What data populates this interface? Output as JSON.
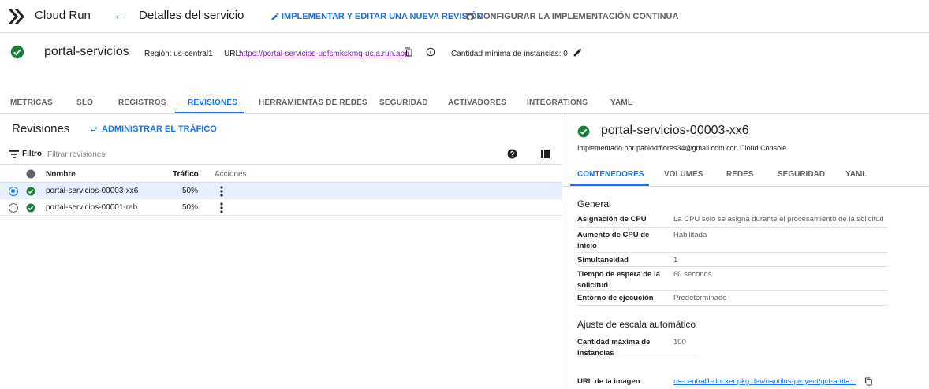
{
  "topbar": {
    "product": "Cloud Run",
    "page_title": "Detalles del servicio",
    "deploy_action": "IMPLEMENTAR Y EDITAR UNA NUEVA REVISIÓN",
    "cd_action": "CONFIGURAR LA IMPLEMENTACIÓN CONTINUA"
  },
  "service": {
    "name": "portal-servicios",
    "region": "Región: us-central1",
    "url_label": "URL:",
    "url": "https://portal-servicios-ugfsmkskmq-uc.a.run.app",
    "min_instances": "Cantidad mínima de instancias: 0"
  },
  "tabs": [
    "MÉTRICAS",
    "SLO",
    "REGISTROS",
    "REVISIONES",
    "HERRAMIENTAS DE REDES",
    "SEGURIDAD",
    "ACTIVADORES",
    "INTEGRATIONS",
    "YAML"
  ],
  "revisions": {
    "title": "Revisiones",
    "manage_traffic": "ADMINISTRAR EL TRÁFICO",
    "filter_label": "Filtro",
    "filter_placeholder": "Filtrar revisiones",
    "columns": {
      "name": "Nombre",
      "traffic": "Tráfico",
      "actions": "Acciones"
    },
    "rows": [
      {
        "name": "portal-servicios-00003-xx6",
        "traffic": "50%"
      },
      {
        "name": "portal-servicios-00001-rab",
        "traffic": "50%"
      }
    ]
  },
  "detail": {
    "title": "portal-servicios-00003-xx6",
    "deployed_by": "Implementado por pablodfflores34@gmail.com con Cloud Console",
    "tabs": [
      "CONTENEDORES",
      "VOLUMES",
      "REDES",
      "SEGURIDAD",
      "YAML"
    ],
    "general_title": "General",
    "general": [
      {
        "key": "Asignación de CPU",
        "value": "La CPU solo se asigna durante el procesamiento de la solicitud"
      },
      {
        "key": "Aumento de CPU de inicio",
        "value": "Habilitada"
      },
      {
        "key": "Simultaneidad",
        "value": "1"
      },
      {
        "key": "Tiempo de espera de la solicitud",
        "value": "60 seconds"
      },
      {
        "key": "Entorno de ejecución",
        "value": "Predeterminado"
      }
    ],
    "scaling_title": "Ajuste de escala automático",
    "scaling": [
      {
        "key": "Cantidad máxima de instancias",
        "value": "100"
      }
    ],
    "image_key": "URL de la imagen",
    "image_value": "us-central1-docker.pkg.dev/nautilus-proyect/gcf-artifa..."
  },
  "colors": {
    "accent": "#1a73e8",
    "success": "#188038",
    "link_visited": "#7b1fa2"
  }
}
